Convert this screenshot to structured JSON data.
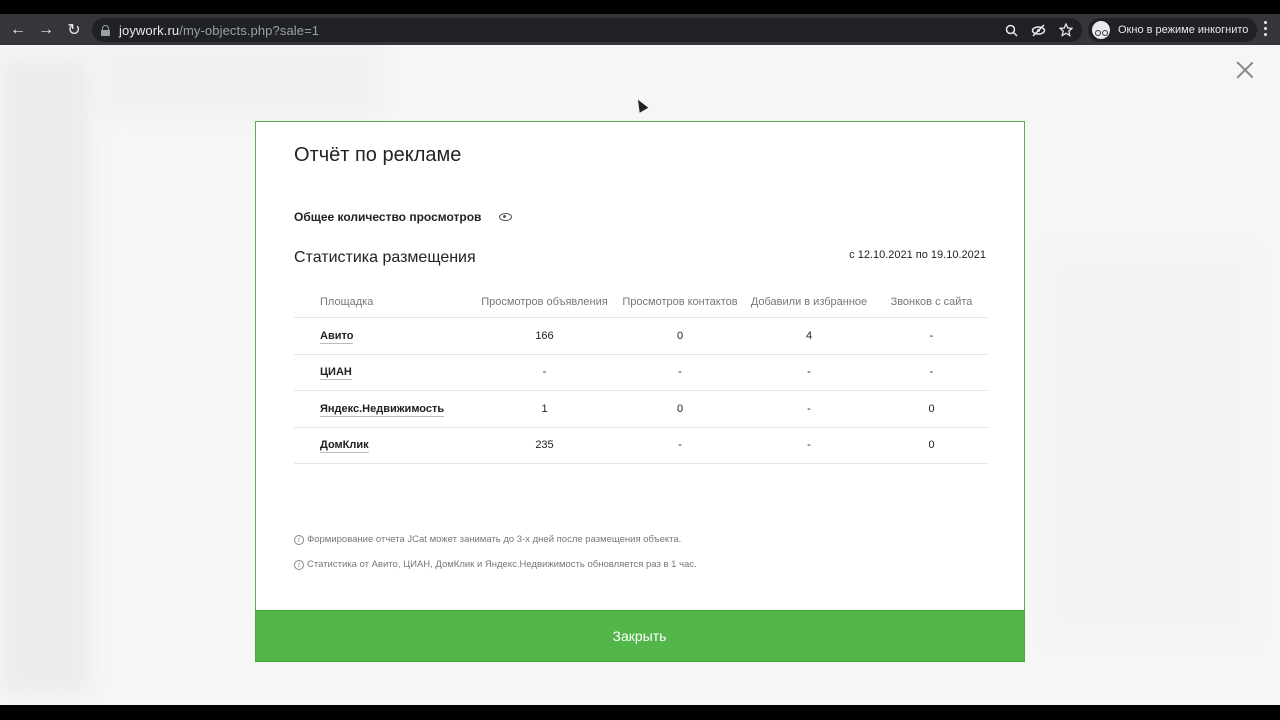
{
  "browser": {
    "url_domain": "joywork.ru",
    "url_path": "/my-objects.php?sale=1",
    "incognito_label": "Окно в режиме инкогнито"
  },
  "modal": {
    "title": "Отчёт по рекламе",
    "views_label": "Общее количество просмотров",
    "stats_title": "Статистика размещения",
    "date_range": "с 12.10.2021 по 19.10.2021",
    "columns": [
      "Площадка",
      "Просмотров объявления",
      "Просмотров контактов",
      "Добавили в избранное",
      "Звонков с сайта"
    ],
    "rows": [
      {
        "site": "Авито",
        "ad_views": "166",
        "contact_views": "0",
        "favorites": "4",
        "calls": "-"
      },
      {
        "site": "ЦИАН",
        "ad_views": "-",
        "contact_views": "-",
        "favorites": "-",
        "calls": "-"
      },
      {
        "site": "Яндекс.Недвижимость",
        "ad_views": "1",
        "contact_views": "0",
        "favorites": "-",
        "calls": "0"
      },
      {
        "site": "ДомКлик",
        "ad_views": "235",
        "contact_views": "-",
        "favorites": "-",
        "calls": "0"
      }
    ],
    "notes": [
      "Формирование отчета JCat может занимать до 3-х дней после размещения объекта.",
      "Статистика от Авито, ЦИАН, ДомКлик и Яндекс.Недвижимость обновляется раз в 1 час."
    ],
    "close_button": "Закрыть"
  },
  "colors": {
    "accent_green": "#52b748",
    "border_green": "#55b24a"
  }
}
